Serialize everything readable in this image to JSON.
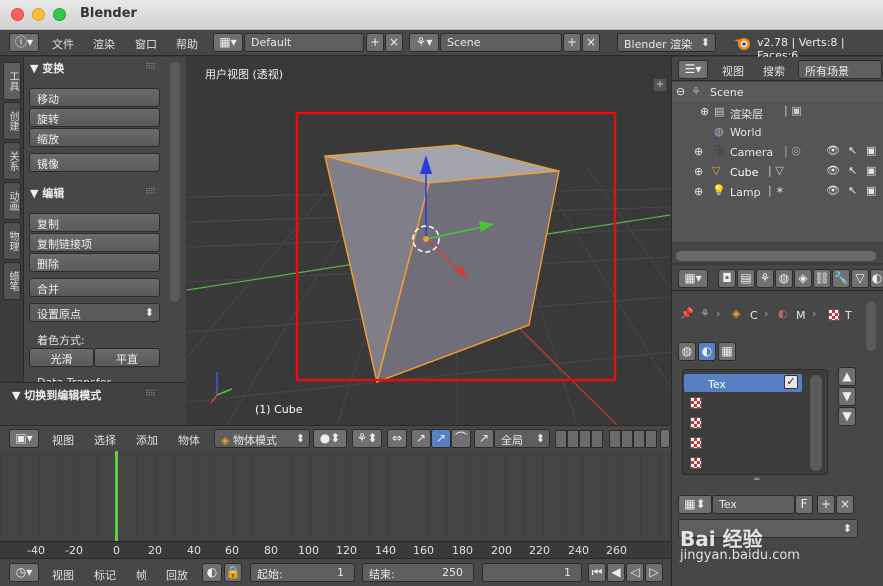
{
  "window": {
    "title": "Blender"
  },
  "topbar": {
    "menus": [
      "文件",
      "渲染",
      "窗口",
      "帮助"
    ],
    "layout": "Default",
    "scene": "Scene",
    "engine": "Blender 渲染",
    "version": "v2.78 | Verts:8 | Faces:6"
  },
  "tool_tabs": [
    "工具",
    "创建",
    "关系",
    "动画",
    "物理",
    "蜡笔"
  ],
  "tools": {
    "transform_header": "变换",
    "move": "移动",
    "rotate": "旋转",
    "scale": "缩放",
    "mirror": "镜像",
    "edit_header": "编辑",
    "duplicate": "复制",
    "duplicate_linked": "复制链接项",
    "delete": "删除",
    "join": "合并",
    "set_origin": "设置原点",
    "shading_label": "着色方式:",
    "smooth": "光滑",
    "flat": "平直",
    "data_transfer": "Data Transfer",
    "operator_header": "切换到编辑模式"
  },
  "viewport": {
    "label": "用户视图 (透视)",
    "object_label": "(1) Cube"
  },
  "vpbar": {
    "menus": [
      "视图",
      "选择",
      "添加",
      "物体"
    ],
    "mode": "物体模式",
    "pivot": "全局"
  },
  "timeline": {
    "ticks": [
      "-40",
      "-20",
      "0",
      "20",
      "40",
      "60",
      "80",
      "100",
      "120",
      "140",
      "160",
      "180",
      "200",
      "220",
      "240",
      "260"
    ],
    "menus": [
      "视图",
      "标记",
      "帧",
      "回放"
    ],
    "start_label": "起始:",
    "start_value": "1",
    "end_label": "结束:",
    "end_value": "250",
    "current": "1"
  },
  "outliner": {
    "menus": [
      "视图",
      "搜索"
    ],
    "filter": "所有场景",
    "rows": [
      {
        "label": "Scene"
      },
      {
        "label": "渲染层"
      },
      {
        "label": "World"
      },
      {
        "label": "Camera"
      },
      {
        "label": "Cube"
      },
      {
        "label": "Lamp"
      }
    ]
  },
  "properties": {
    "breadcrumb_c": "C",
    "breadcrumb_m": "M",
    "breadcrumb_t": "T",
    "texture_slot": "Tex",
    "tex_field": "Tex",
    "tex_f": "F"
  },
  "watermark": {
    "brand": "Bai 经验",
    "url": "jingyan.baidu.com"
  },
  "colors": {
    "selection": "#ff9a20",
    "highlight_box": "#e01010",
    "frame_line": "#5ad23c",
    "slot_selected": "#5680c2"
  }
}
